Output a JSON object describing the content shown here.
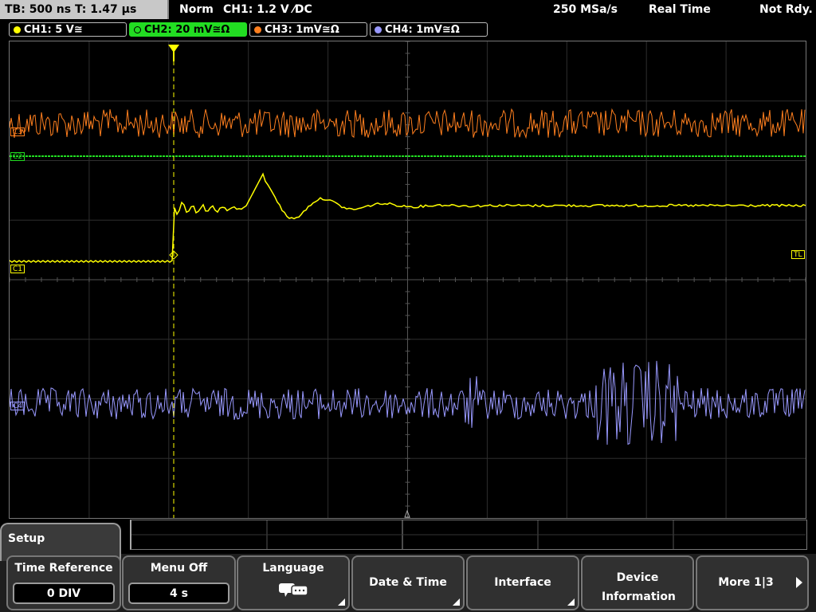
{
  "status": {
    "timebase": "TB: 500 ns  T: 1.47 µs",
    "mode": "Norm",
    "trigger": "CH1: 1.2 V ⁄DC",
    "sample_rate": "250 MSa/s",
    "acq": "Real Time",
    "state": "Not Rdy."
  },
  "channels": [
    {
      "label": "CH1: 5 V≅",
      "color": "#ffff00"
    },
    {
      "label": "CH2: 20 mV≅Ω",
      "color": "#22dd22"
    },
    {
      "label": "CH3: 1mV≅Ω",
      "color": "#ff7f1e"
    },
    {
      "label": "CH4: 1mV≅Ω",
      "color": "#9999ff"
    }
  ],
  "markers": {
    "trigger": "T",
    "c1": "C1",
    "c2": "C2",
    "c3": "C3",
    "c4": "C4",
    "tl": "TL"
  },
  "menu": {
    "title": "Setup",
    "buttons": [
      {
        "label": "Time Reference",
        "value": "0 DIV"
      },
      {
        "label": "Menu Off",
        "value": "4 s"
      },
      {
        "label": "Language"
      },
      {
        "label": "Date & Time"
      },
      {
        "label": "Interface"
      },
      {
        "label": "Device Information"
      },
      {
        "label": "More 1|3"
      }
    ]
  }
}
